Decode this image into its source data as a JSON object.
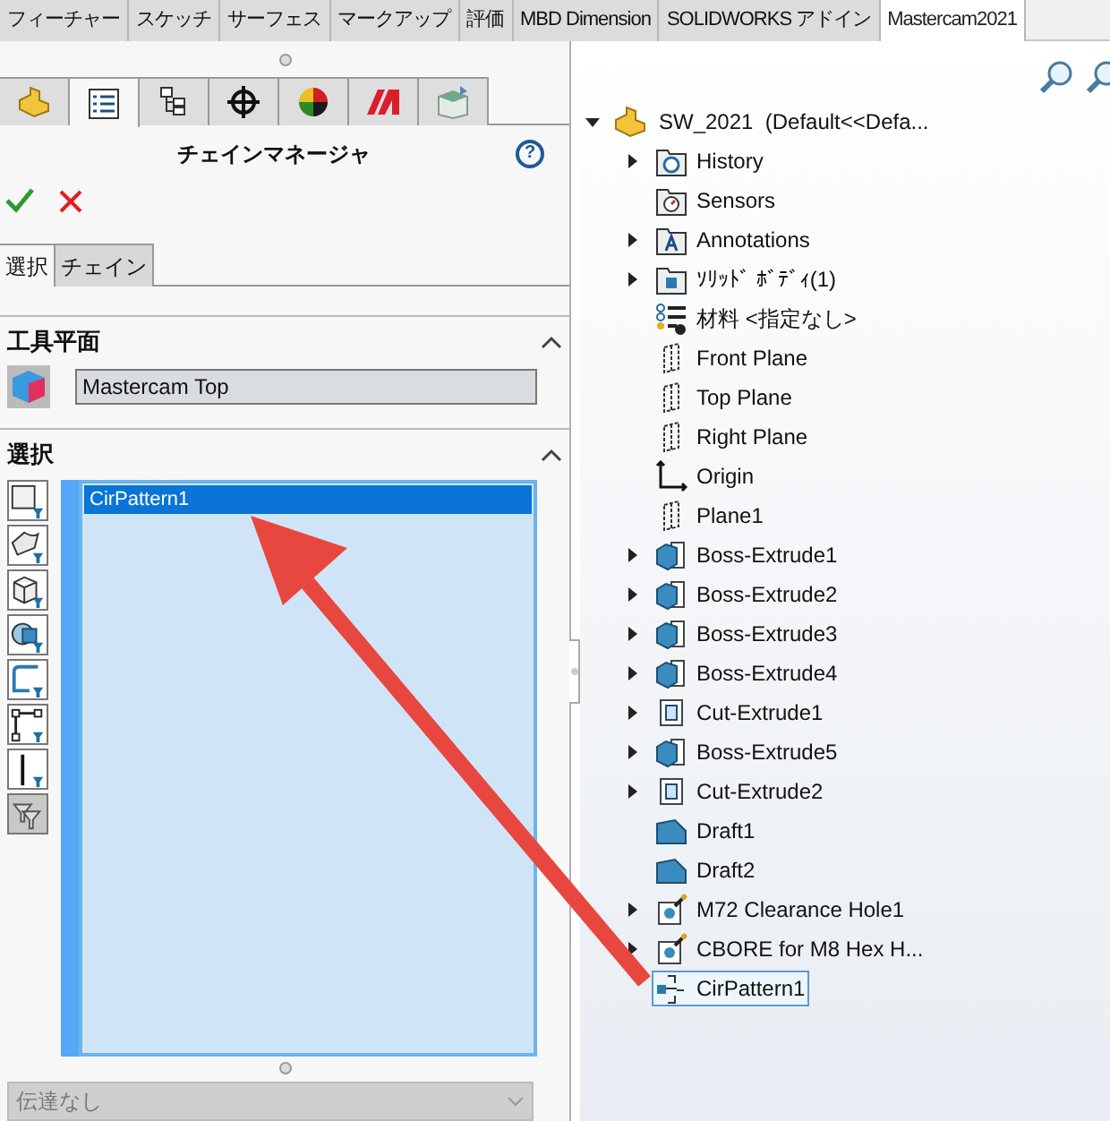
{
  "ribbon_tabs": [
    {
      "label": "フィーチャー",
      "selected": false
    },
    {
      "label": "スケッチ",
      "selected": false
    },
    {
      "label": "サーフェス",
      "selected": false
    },
    {
      "label": "マークアップ",
      "selected": false
    },
    {
      "label": "評価",
      "selected": false
    },
    {
      "label": "MBD Dimension",
      "selected": false
    },
    {
      "label": "SOLIDWORKS アドイン",
      "selected": false
    },
    {
      "label": "Mastercam2021",
      "selected": true
    }
  ],
  "panel": {
    "icon_tabs": [
      {
        "kind": "part",
        "selected": false
      },
      {
        "kind": "property",
        "selected": true
      },
      {
        "kind": "config",
        "selected": false
      },
      {
        "kind": "target",
        "selected": false
      },
      {
        "kind": "appearance",
        "selected": false
      },
      {
        "kind": "mastercam",
        "selected": false
      },
      {
        "kind": "display",
        "selected": false
      }
    ],
    "title": "チェインマネージャ",
    "help": "?",
    "sub_tabs": [
      {
        "label": "選択",
        "selected": true
      },
      {
        "label": "チェイン",
        "selected": false
      }
    ],
    "tool_plane": {
      "heading": "工具平面",
      "expanded": true,
      "value": "Mastercam Top"
    },
    "selection": {
      "heading": "選択",
      "expanded": true,
      "filters": [
        {
          "kind": "edge",
          "selected": false
        },
        {
          "kind": "face",
          "selected": false
        },
        {
          "kind": "body",
          "selected": false
        },
        {
          "kind": "feature",
          "selected": false
        },
        {
          "kind": "loop",
          "selected": false
        },
        {
          "kind": "vertex",
          "selected": false
        },
        {
          "kind": "line",
          "selected": false
        },
        {
          "kind": "clear",
          "selected": true
        }
      ],
      "items": [
        {
          "label": "CirPattern1",
          "selected": true
        }
      ]
    },
    "propagation": {
      "value": "伝達なし",
      "disabled": true
    }
  },
  "tree": {
    "root": {
      "label": "SW_2021  (Default<<Defa...",
      "expanded": true
    },
    "items": [
      {
        "label": "History",
        "kind": "history",
        "expandable": true,
        "selected": false
      },
      {
        "label": "Sensors",
        "kind": "sensors",
        "expandable": false,
        "selected": false
      },
      {
        "label": "Annotations",
        "kind": "annotations",
        "expandable": true,
        "selected": false
      },
      {
        "label": "ｿﾘｯﾄﾞ ﾎﾞﾃﾞｨ(1)",
        "kind": "bodies",
        "expandable": true,
        "selected": false
      },
      {
        "label": "材料 <指定なし>",
        "kind": "material",
        "expandable": false,
        "selected": false
      },
      {
        "label": "Front Plane",
        "kind": "plane",
        "expandable": false,
        "selected": false
      },
      {
        "label": "Top Plane",
        "kind": "plane",
        "expandable": false,
        "selected": false
      },
      {
        "label": "Right Plane",
        "kind": "plane",
        "expandable": false,
        "selected": false
      },
      {
        "label": "Origin",
        "kind": "origin",
        "expandable": false,
        "selected": false
      },
      {
        "label": "Plane1",
        "kind": "plane",
        "expandable": false,
        "selected": false
      },
      {
        "label": "Boss-Extrude1",
        "kind": "boss",
        "expandable": true,
        "selected": false
      },
      {
        "label": "Boss-Extrude2",
        "kind": "boss",
        "expandable": true,
        "selected": false
      },
      {
        "label": "Boss-Extrude3",
        "kind": "boss",
        "expandable": true,
        "selected": false
      },
      {
        "label": "Boss-Extrude4",
        "kind": "boss",
        "expandable": true,
        "selected": false
      },
      {
        "label": "Cut-Extrude1",
        "kind": "cut",
        "expandable": true,
        "selected": false
      },
      {
        "label": "Boss-Extrude5",
        "kind": "boss",
        "expandable": true,
        "selected": false
      },
      {
        "label": "Cut-Extrude2",
        "kind": "cut",
        "expandable": true,
        "selected": false
      },
      {
        "label": "Draft1",
        "kind": "draft",
        "expandable": false,
        "selected": false
      },
      {
        "label": "Draft2",
        "kind": "draft",
        "expandable": false,
        "selected": false
      },
      {
        "label": "M72 Clearance Hole1",
        "kind": "hole",
        "expandable": true,
        "selected": false
      },
      {
        "label": "CBORE for M8 Hex H...",
        "kind": "hole",
        "expandable": true,
        "selected": false
      },
      {
        "label": "CirPattern1",
        "kind": "pattern",
        "expandable": false,
        "selected": true
      }
    ]
  }
}
